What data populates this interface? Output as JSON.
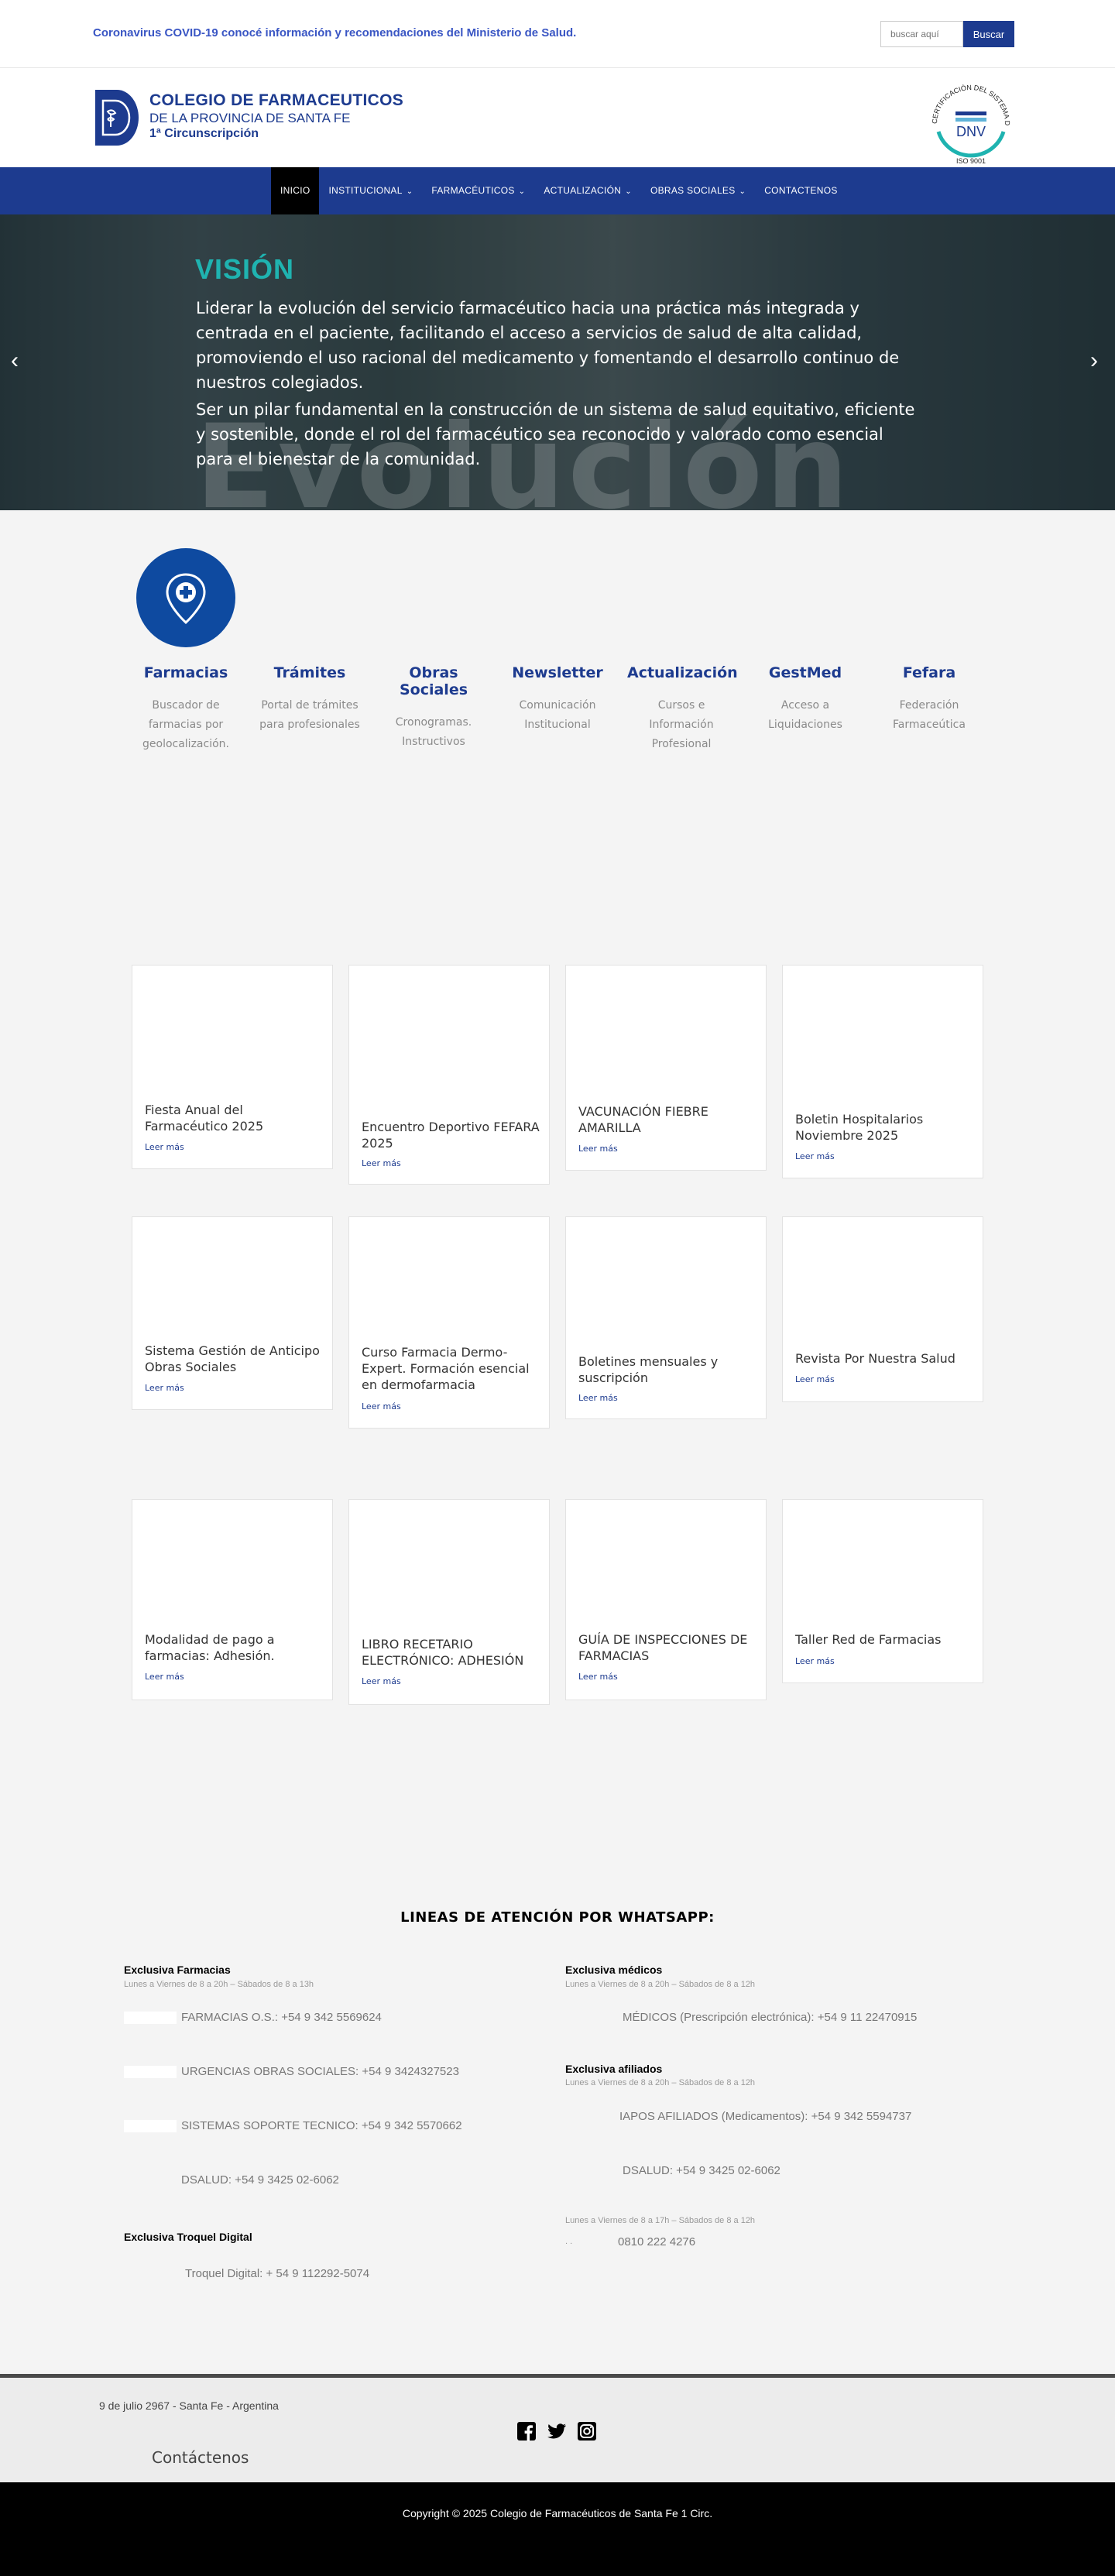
{
  "topbar": {
    "covid_text": "Coronavirus COVID-19 conocé información y recomendaciones del Ministerio de Salud.",
    "search_placeholder": "buscar aquí",
    "search_button": "Buscar"
  },
  "header": {
    "logo_line1": "COLEGIO DE FARMACEUTICOS",
    "logo_line2": "DE LA PROVINCIA DE SANTA FE",
    "logo_line3": "1ª Circunscripción",
    "cert_ring": "CERTIFICACIÓN DEL SISTEMA DE CALIDAD",
    "cert_brand": "DNV",
    "cert_iso": "ISO 9001"
  },
  "nav": {
    "items": [
      {
        "label": "INICIO"
      },
      {
        "label": "INSTITUCIONAL"
      },
      {
        "label": "FARMACÉUTICOS"
      },
      {
        "label": "ACTUALIZACIÓN"
      },
      {
        "label": "OBRAS SOCIALES"
      },
      {
        "label": "CONTACTENOS"
      }
    ]
  },
  "hero": {
    "title": "VISIÓN",
    "paragraph1": "Liderar la evolución del servicio farmacéutico hacia una práctica más  integrada y centrada en el paciente, facilitando el acceso a servicios de salud de alta calidad, promoviendo el uso racional del medicamento y fomentando el desarrollo continuo de nuestros colegiados.",
    "paragraph2": "Ser un pilar fundamental en la construcción de un sistema de salud equitativo, eficiente y sostenible, donde el rol del farmacéutico sea reconocido y valorado como esencial para el bienestar de la comunidad.",
    "background_word": "Evolución"
  },
  "features": [
    {
      "title": "Farmacias",
      "desc": "Buscador de farmacias por geolocalización."
    },
    {
      "title": "Trámites",
      "desc": "Portal de trámites para profesionales"
    },
    {
      "title": "Obras Sociales",
      "desc": "Cronogramas. Instructivos"
    },
    {
      "title": "Newsletter",
      "desc": "Comunicación Institucional"
    },
    {
      "title": "Actualización",
      "desc": "Cursos e Información Profesional"
    },
    {
      "title": "GestMed",
      "desc": "Acceso a Liquidaciones"
    },
    {
      "title": "Fefara",
      "desc": "Federación Farmaceútica"
    }
  ],
  "cards": {
    "read_more": "Leer más",
    "items": [
      {
        "title": "Fiesta Anual del Farmacéutico 2025"
      },
      {
        "title": "Encuentro Deportivo FEFARA 2025"
      },
      {
        "title": "VACUNACIÓN FIEBRE AMARILLA"
      },
      {
        "title": "Boletin Hospitalarios Noviembre 2025"
      },
      {
        "title": "Sistema Gestión de Anticipo Obras Sociales"
      },
      {
        "title": "Curso Farmacia Dermo-Expert. Formación esencial en dermofarmacia"
      },
      {
        "title": "Boletines mensuales y suscripción"
      },
      {
        "title": "Revista Por Nuestra Salud"
      },
      {
        "title": "Modalidad de pago a farmacias: Adhesión."
      },
      {
        "title": "LIBRO RECETARIO ELECTRÓNICO: ADHESIÓN"
      },
      {
        "title": "GUÍA DE INSPECCIONES DE FARMACIAS"
      },
      {
        "title": "Taller Red de Farmacias"
      }
    ]
  },
  "whatsapp": {
    "title": "LINEAS DE ATENCIÓN POR WHATSAPP:",
    "farmacias": {
      "heading": "Exclusiva Farmacias",
      "hours": "Lunes a Viernes de 8 a 20h – Sábados de 8 a 13h",
      "lines": [
        "FARMACIAS O.S.: +54 9 342 5569624",
        "URGENCIAS OBRAS SOCIALES: +54 9 3424327523",
        "SISTEMAS SOPORTE TECNICO: +54 9 342 5570662",
        "DSALUD: +54 9 3425 02-6062"
      ]
    },
    "troquel": {
      "heading": "Exclusiva Troquel Digital",
      "line": "Troquel Digital: + 54 9 112292-5074"
    },
    "medicos": {
      "heading": "Exclusiva médicos",
      "hours": "Lunes a Viernes de 8 a 20h – Sábados de 8 a 12h",
      "line": "MÉDICOS (Prescripción electrónica): +54 9 11 22470915"
    },
    "afiliados": {
      "heading": "Exclusiva afiliados",
      "hours": "Lunes a Viernes de 8 a 20h – Sábados de 8 a 12h",
      "lines": [
        "IAPOS AFILIADOS (Medicamentos):  +54 9 342 5594737",
        "DSALUD: +54 9 3425 02-6062"
      ]
    },
    "extra": {
      "hours": "Lunes a Viernes de 8 a 17h – Sábados de 8 a 12h",
      "prefix": ". .",
      "line": "0810 222 4276"
    }
  },
  "footer": {
    "address": "9 de julio 2967 - Santa Fe - Argentina",
    "contact": "Contáctenos",
    "copyright": "Copyright © 2025 Colegio de Farmacéuticos de Santa Fe 1 Circ."
  },
  "colors": {
    "brand_blue": "#1d3b8f",
    "teal": "#1fb3b0",
    "circle_blue": "#0e4aa0"
  }
}
